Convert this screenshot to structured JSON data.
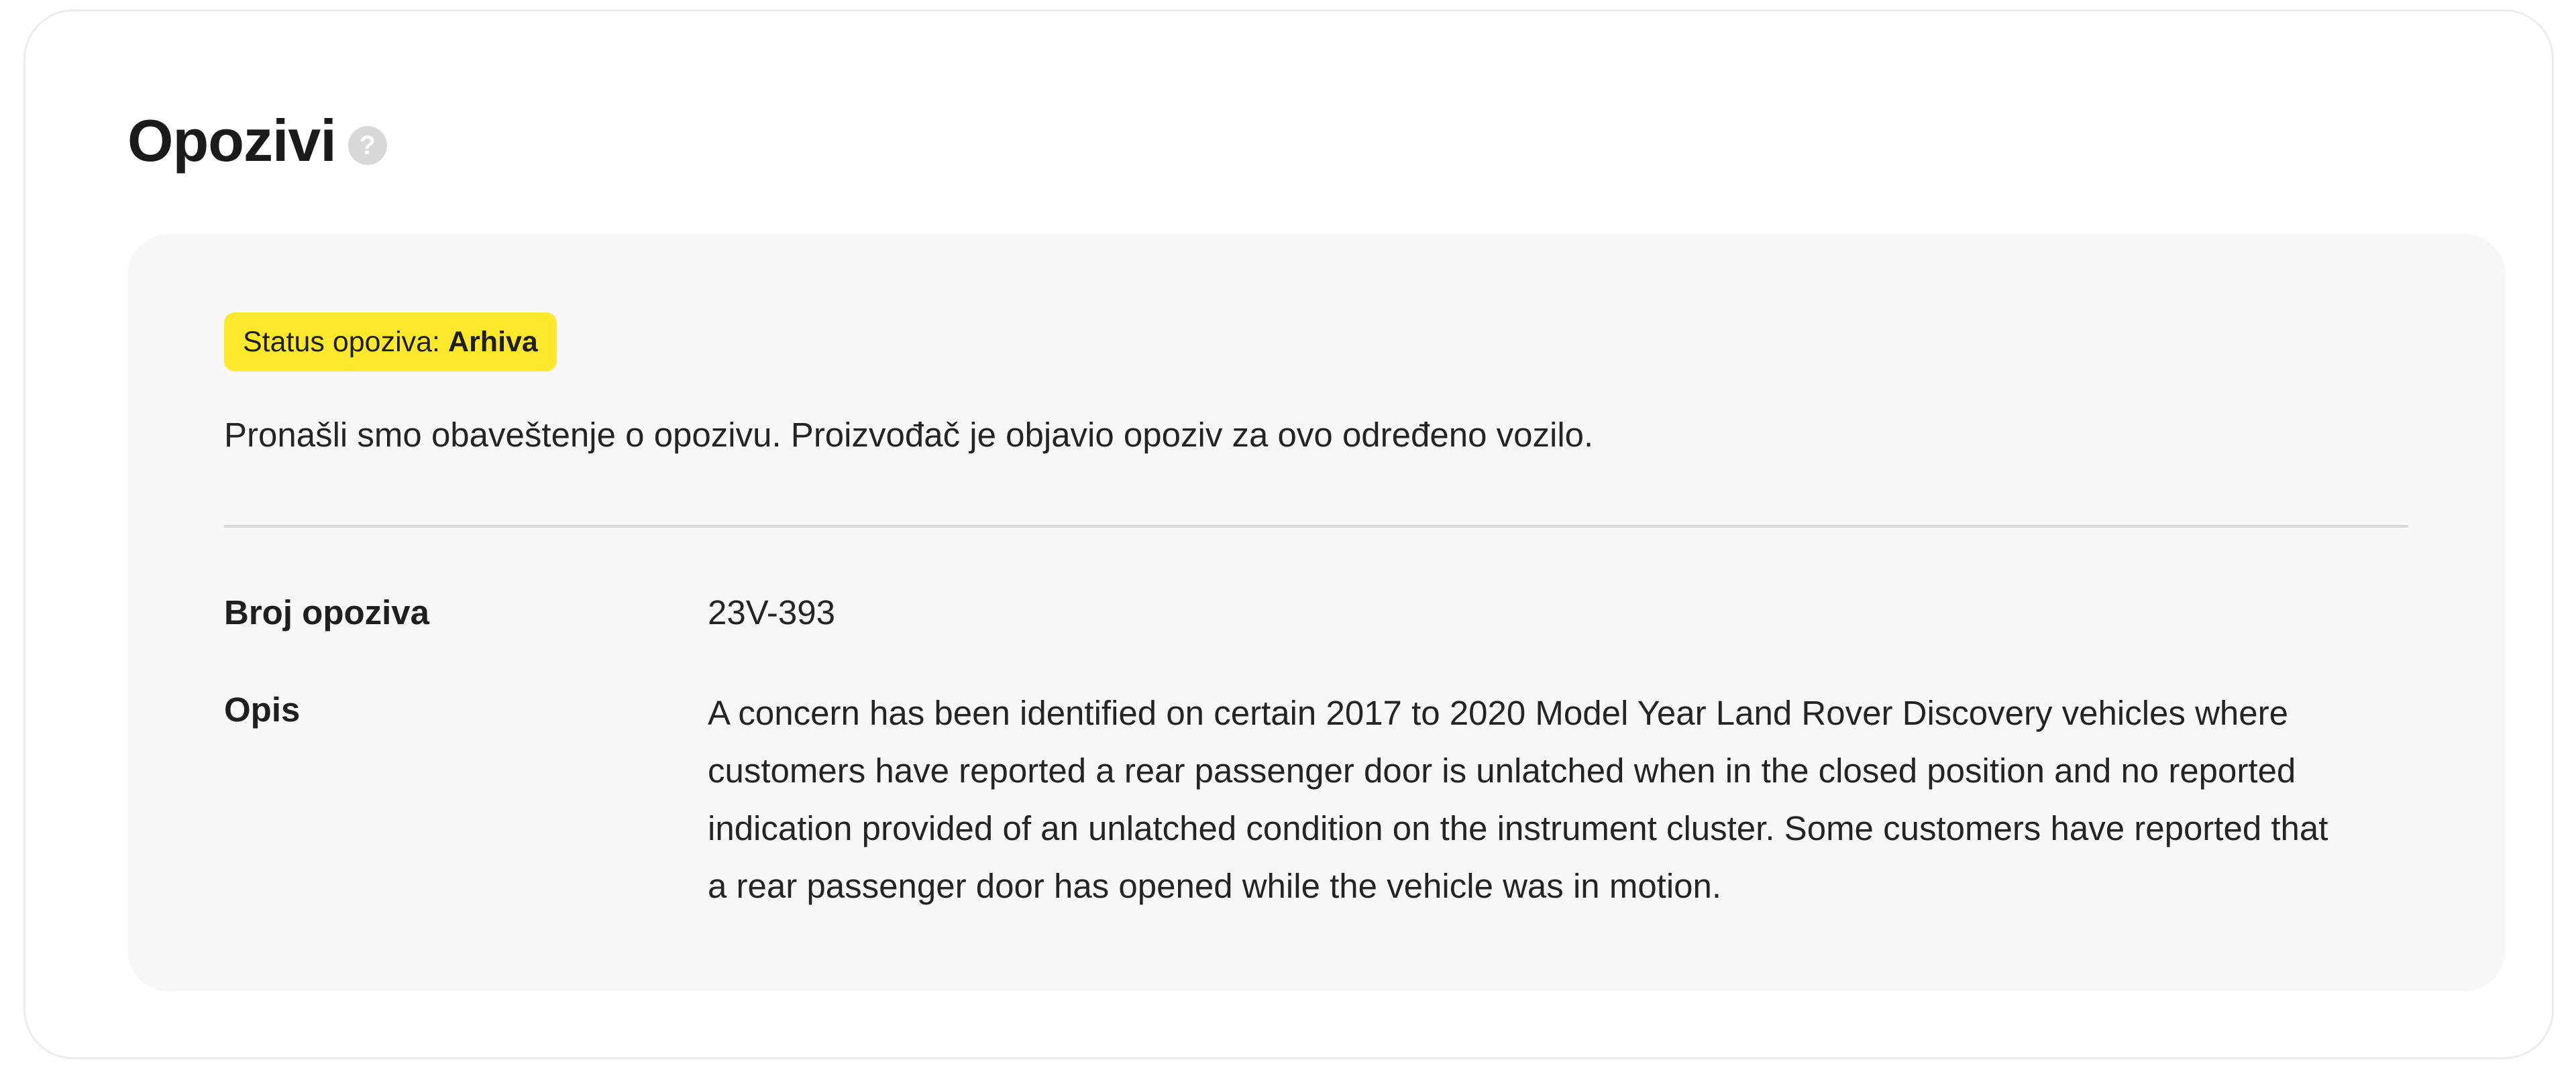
{
  "header": {
    "title": "Opozivi",
    "help_icon_glyph": "?"
  },
  "status": {
    "label": "Status opoziva:",
    "value": "Arhiva",
    "badge_color": "#fde82b"
  },
  "notice": {
    "text": "Pronašli smo obaveštenje o opozivu. Proizvođač je objavio opoziv za ovo određeno vozilo."
  },
  "details": {
    "recall_number": {
      "label": "Broj opoziva",
      "value": "23V-393"
    },
    "description": {
      "label": "Opis",
      "lines": [
        "A concern has been identified on certain 2017 to 2020 Model Year Land Rover Discovery vehicles where",
        "customers have reported a rear passenger door is unlatched when in the closed position and no reported",
        "indication provided of an unlatched condition on the instrument cluster. Some customers have reported that",
        "a rear passenger door has opened while the vehicle was in motion."
      ]
    }
  }
}
